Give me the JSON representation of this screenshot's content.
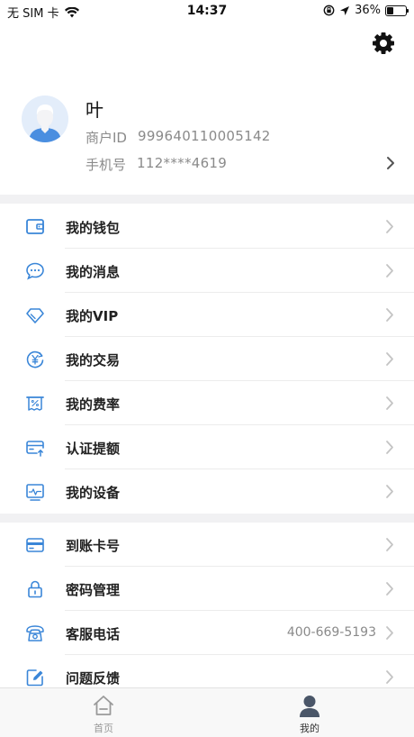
{
  "status_bar": {
    "carrier": "无 SIM 卡",
    "time": "14:37",
    "battery": "36%",
    "battery_level": 0.36
  },
  "profile": {
    "name": "叶",
    "merchant_id_label": "商户ID",
    "merchant_id": "999640110005142",
    "phone_label": "手机号",
    "phone": "112****4619"
  },
  "menu_group_1": [
    {
      "label": "我的钱包",
      "icon": "wallet-icon"
    },
    {
      "label": "我的消息",
      "icon": "message-icon"
    },
    {
      "label": "我的VIP",
      "icon": "diamond-icon"
    },
    {
      "label": "我的交易",
      "icon": "yen-cycle-icon"
    },
    {
      "label": "我的费率",
      "icon": "rate-icon"
    },
    {
      "label": "认证提额",
      "icon": "card-upload-icon"
    },
    {
      "label": "我的设备",
      "icon": "device-icon"
    }
  ],
  "menu_group_2": [
    {
      "label": "到账卡号",
      "icon": "bank-card-icon",
      "extra": ""
    },
    {
      "label": "密码管理",
      "icon": "lock-icon",
      "extra": ""
    },
    {
      "label": "客服电话",
      "icon": "telephone-icon",
      "extra": "400-669-5193"
    },
    {
      "label": "问题反馈",
      "icon": "feedback-edit-icon",
      "extra": ""
    }
  ],
  "tab_bar": {
    "home": "首页",
    "mine": "我的"
  },
  "colors": {
    "accent": "#3a86d8",
    "tab_active": "#4a5668"
  }
}
